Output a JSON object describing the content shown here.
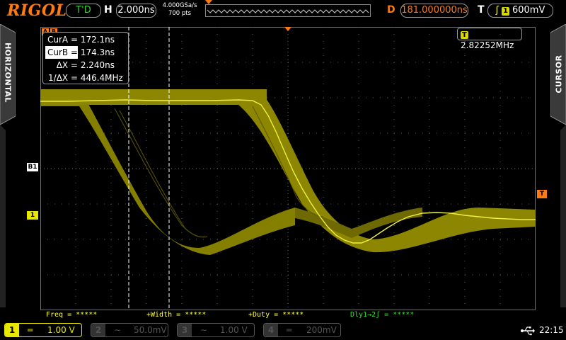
{
  "header": {
    "brand": "RIGOL",
    "run_state": "T'D",
    "timebase_label": "H",
    "timebase_value": "2.000ns",
    "sample_rate": "4.000GSa/s",
    "memory_depth": "700 pts",
    "delay_label": "D",
    "delay_value": "181.000000ns",
    "trigger_label": "T",
    "trigger_source": "1",
    "trigger_level": "600mV"
  },
  "side_tabs": {
    "left": "HORIZONTAL",
    "right": "CURSOR"
  },
  "markers": {
    "cursor_a": "A",
    "cursor_b": "B",
    "ref_b1": "B1",
    "ch1": "1",
    "trigger": "T"
  },
  "cursor_panel": {
    "rows": [
      {
        "label": "CurA =",
        "value": "172.1ns"
      },
      {
        "label": "CurB =",
        "value": "174.3ns"
      },
      {
        "label": "ΔX =",
        "value": "2.240ns"
      },
      {
        "label": "1/ΔX =",
        "value": "446.4MHz"
      }
    ]
  },
  "frequency_counter": {
    "chip": "T",
    "value": "2.82252MHz"
  },
  "measurements": [
    {
      "text": "Freq = *****",
      "color": "#ffff33"
    },
    {
      "text": "+Width = *****",
      "color": "#ffff33"
    },
    {
      "text": "+Duty = *****",
      "color": "#ffff33"
    },
    {
      "text": "Dly1→2ʃ = *****",
      "color": "#33dd33"
    }
  ],
  "channels": [
    {
      "number": "1",
      "coupling": "═",
      "scale": "1.00 V",
      "active": true,
      "color": "#e8e800"
    },
    {
      "number": "2",
      "coupling": "∼",
      "scale": "50.0mV",
      "active": false,
      "color": "#555555"
    },
    {
      "number": "3",
      "coupling": "∼",
      "scale": "1.00 V",
      "active": false,
      "color": "#555555"
    },
    {
      "number": "4",
      "coupling": "═",
      "scale": "200mV",
      "active": false,
      "color": "#555555"
    }
  ],
  "status": {
    "usb_icon": "usb-icon",
    "time": "22:15"
  },
  "colors": {
    "accent": "#ff7a10",
    "trace": "#9a9400",
    "trace_line": "#f0f040",
    "grid": "#707070"
  }
}
